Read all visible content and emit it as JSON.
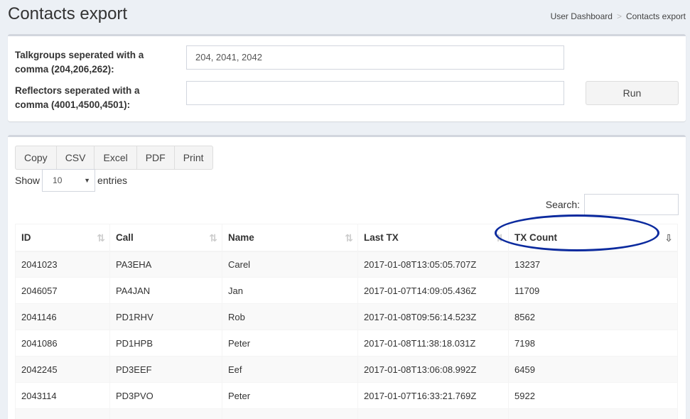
{
  "header": {
    "title": "Contacts export",
    "breadcrumb": [
      "User Dashboard",
      "Contacts export"
    ]
  },
  "form": {
    "talkgroups_label": "Talkgroups seperated with a comma (204,206,262):",
    "talkgroups_value": "204, 2041, 2042",
    "reflectors_label": "Reflectors seperated with a comma (4001,4500,4501):",
    "reflectors_value": "",
    "run_label": "Run"
  },
  "export_buttons": [
    "Copy",
    "CSV",
    "Excel",
    "PDF",
    "Print"
  ],
  "length": {
    "show_label": "Show",
    "value": "10",
    "entries_label": "entries"
  },
  "search": {
    "label": "Search:",
    "value": ""
  },
  "table": {
    "columns": [
      "ID",
      "Call",
      "Name",
      "Last TX",
      "TX Count"
    ],
    "sorted_column": "TX Count",
    "rows": [
      [
        "2041023",
        "PA3EHA",
        "Carel",
        "2017-01-08T13:05:05.707Z",
        "13237"
      ],
      [
        "2046057",
        "PA4JAN",
        "Jan",
        "2017-01-07T14:09:05.436Z",
        "11709"
      ],
      [
        "2041146",
        "PD1RHV",
        "Rob",
        "2017-01-08T09:56:14.523Z",
        "8562"
      ],
      [
        "2041086",
        "PD1HPB",
        "Peter",
        "2017-01-08T11:38:18.031Z",
        "7198"
      ],
      [
        "2042245",
        "PD3EEF",
        "Eef",
        "2017-01-08T13:06:08.992Z",
        "6459"
      ],
      [
        "2043114",
        "PD3PVO",
        "Peter",
        "2017-01-07T16:33:21.769Z",
        "5922"
      ],
      [
        "",
        "",
        "",
        "",
        ""
      ]
    ]
  },
  "colors": {
    "annotation": "#0b2a9e"
  }
}
